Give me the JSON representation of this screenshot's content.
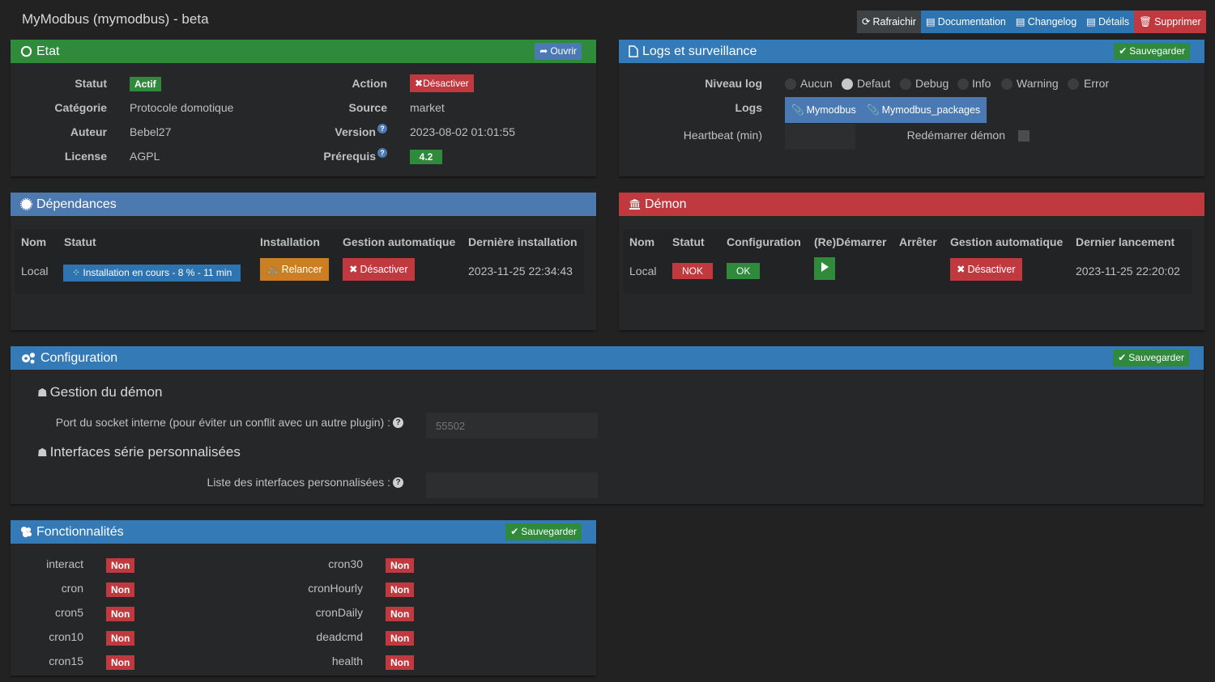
{
  "page": {
    "title": "MyModbus (mymodbus) - beta"
  },
  "top_actions": {
    "refresh": "Rafraichir",
    "documentation": "Documentation",
    "changelog": "Changelog",
    "details": "Détails",
    "delete": "Supprimer"
  },
  "colors": {
    "success": "#2f8a3b",
    "danger": "#c0393f",
    "primary": "#337ab7",
    "warning": "#c97f22",
    "background": "#222222",
    "panel": "#262728"
  },
  "etat": {
    "title": "Etat",
    "open_button": "Ouvrir",
    "labels": {
      "statut": "Statut",
      "categorie": "Catégorie",
      "auteur": "Auteur",
      "license": "License",
      "action": "Action",
      "source": "Source",
      "version": "Version",
      "prerequis": "Prérequis"
    },
    "values": {
      "statut": "Actif",
      "categorie": "Protocole domotique",
      "auteur": "Bebel27",
      "license": "AGPL",
      "action": "Désactiver",
      "source": "market",
      "version": "2023-08-02 01:01:55",
      "prerequis": "4.2"
    },
    "help_glyph": "?"
  },
  "logs": {
    "title": "Logs et surveillance",
    "save_button": "Sauvegarder",
    "niveau_label": "Niveau log",
    "levels": [
      "Aucun",
      "Defaut",
      "Debug",
      "Info",
      "Warning",
      "Error"
    ],
    "selected_level": "Defaut",
    "logs_label": "Logs",
    "log_buttons": [
      "Mymodbus",
      "Mymodbus_packages"
    ],
    "heartbeat_label": "Heartbeat (min)",
    "heartbeat_value": "",
    "restart_label": "Redémarrer démon",
    "restart_checked": false
  },
  "dependances": {
    "title": "Dépendances",
    "headers": [
      "Nom",
      "Statut",
      "Installation",
      "Gestion automatique",
      "Dernière installation"
    ],
    "row": {
      "nom": "Local",
      "statut": "Installation en cours - 8 % - 11 min",
      "installation": "Relancer",
      "gestion": "Désactiver",
      "derniere": "2023-11-25 22:34:43"
    }
  },
  "demon": {
    "title": "Démon",
    "headers": [
      "Nom",
      "Statut",
      "Configuration",
      "(Re)Démarrer",
      "Arrêter",
      "Gestion automatique",
      "Dernier lancement"
    ],
    "row": {
      "nom": "Local",
      "statut": "NOK",
      "configuration": "OK",
      "gestion": "Désactiver",
      "dernier": "2023-11-25 22:20:02"
    }
  },
  "configuration": {
    "title": "Configuration",
    "save_button": "Sauvegarder",
    "section1": "Gestion du démon",
    "port_label": "Port du socket interne (pour éviter un conflit avec un autre plugin) :",
    "port_placeholder": "55502",
    "port_value": "",
    "section2": "Interfaces série personnalisées",
    "interfaces_label": "Liste des interfaces personnalisées :",
    "interfaces_value": ""
  },
  "fonctionnalites": {
    "title": "Fonctionnalités",
    "save_button": "Sauvegarder",
    "left": [
      {
        "name": "interact",
        "value": "Non"
      },
      {
        "name": "cron",
        "value": "Non"
      },
      {
        "name": "cron5",
        "value": "Non"
      },
      {
        "name": "cron10",
        "value": "Non"
      },
      {
        "name": "cron15",
        "value": "Non"
      }
    ],
    "right": [
      {
        "name": "cron30",
        "value": "Non"
      },
      {
        "name": "cronHourly",
        "value": "Non"
      },
      {
        "name": "cronDaily",
        "value": "Non"
      },
      {
        "name": "deadcmd",
        "value": "Non"
      },
      {
        "name": "health",
        "value": "Non"
      }
    ]
  }
}
